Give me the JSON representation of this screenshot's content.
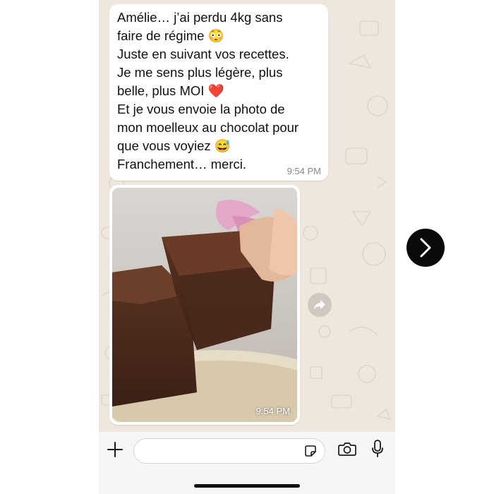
{
  "message": {
    "lines": [
      "Amélie… j’ai perdu 4kg sans",
      "faire de régime 😳",
      "Juste en suivant vos recettes.",
      "Je me sens plus légère, plus",
      "belle, plus MOI ❤️",
      "Et je vous envoie la photo de",
      "mon moelleux au chocolat pour",
      "que vous voyiez 😅",
      "Franchement… merci."
    ],
    "time": "9:54 PM"
  },
  "image_message": {
    "time": "9:54 PM",
    "photo_icon": "chocolate-cake-photo"
  },
  "icons": {
    "forward": "forward-arrow-icon",
    "attach": "plus-icon",
    "sticker": "sticker-icon",
    "camera": "camera-icon",
    "mic": "microphone-icon",
    "next": "chevron-right-icon"
  },
  "colors": {
    "chat_background": "#efe7dd",
    "bubble": "#ffffff",
    "timestamp": "#8a8a8a"
  }
}
